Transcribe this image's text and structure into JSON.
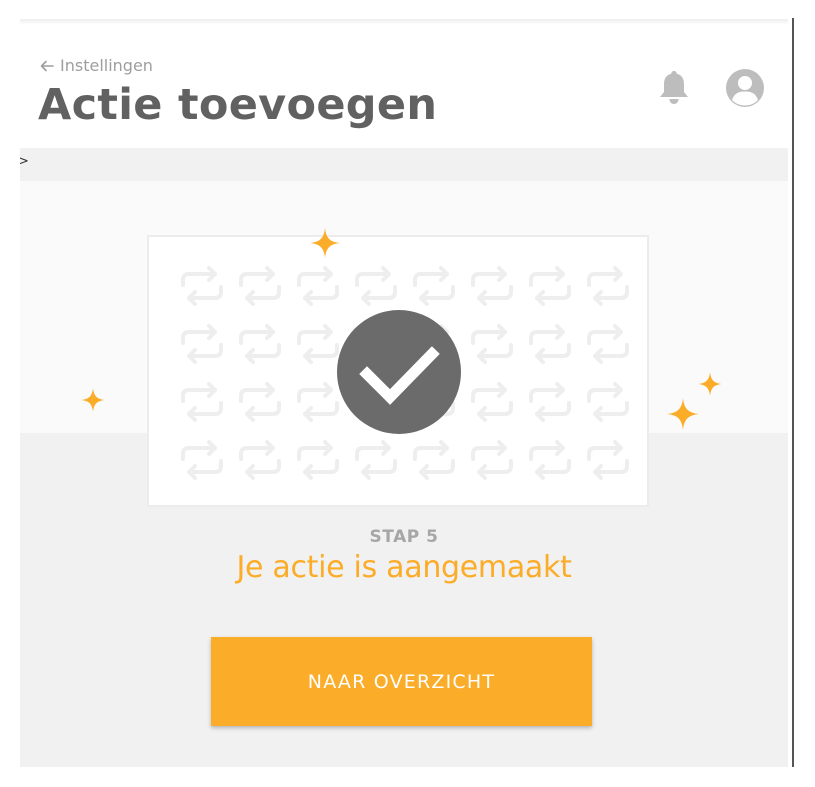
{
  "header": {
    "back_label": "Instellingen",
    "title": "Actie toevoegen"
  },
  "breadcrumb": {
    "separator": ">"
  },
  "success": {
    "step_label": "STAP 5",
    "message": "Je actie is aangemaakt",
    "button_label": "NAAR OVERZICHT"
  },
  "icons": {
    "back": "arrow-left-icon",
    "notifications": "bell-icon",
    "account": "user-avatar-icon",
    "success": "checkmark-icon",
    "pattern": "repeat-arrows-icon",
    "sparkle": "sparkle-icon"
  },
  "colors": {
    "accent": "#fbac28",
    "title_text": "#616161",
    "muted_text": "#9e9e9e",
    "icon_gray": "#bdbdbd",
    "check_circle": "#6b6b6b"
  }
}
